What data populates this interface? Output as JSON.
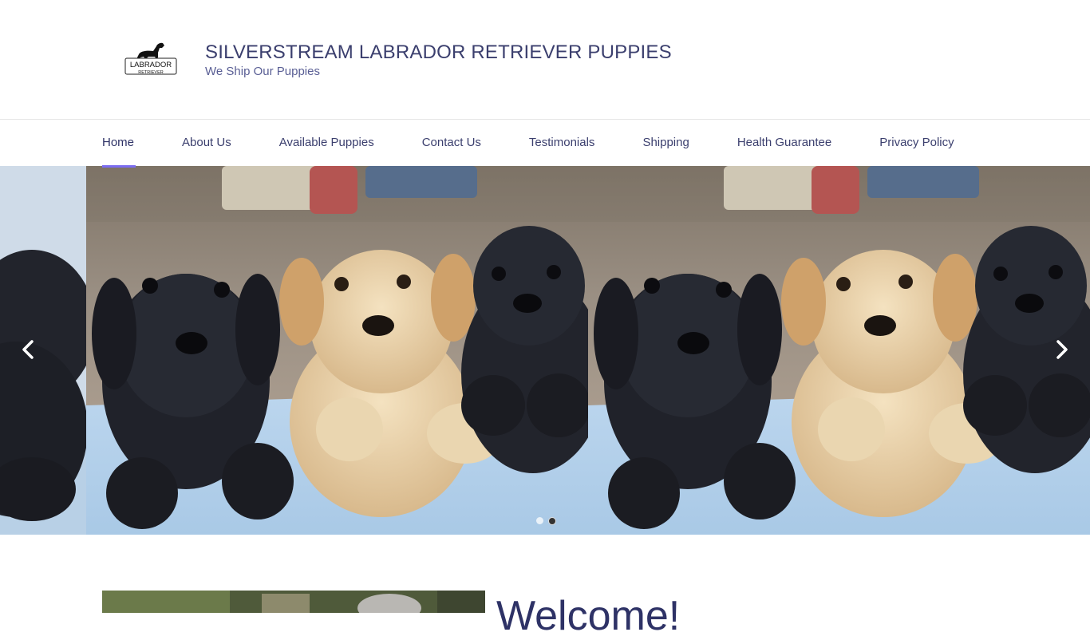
{
  "header": {
    "logo_text_top": "LABRADOR",
    "logo_text_bottom": "RETRIEVER",
    "site_title": "SILVERSTREAM LABRADOR RETRIEVER PUPPIES",
    "tagline": "We Ship Our Puppies"
  },
  "nav": {
    "items": [
      {
        "label": "Home"
      },
      {
        "label": "About Us"
      },
      {
        "label": "Available Puppies"
      },
      {
        "label": "Contact Us"
      },
      {
        "label": "Testimonials"
      },
      {
        "label": "Shipping"
      },
      {
        "label": "Health Guarantee"
      },
      {
        "label": "Privacy Policy"
      }
    ],
    "active": "Home"
  },
  "slider": {
    "icons": {
      "prev": "chevron-left-icon",
      "next": "chevron-right-icon"
    },
    "slides": [
      {
        "name": "three-labrador-puppies-photo"
      },
      {
        "name": "three-labrador-puppies-photo"
      }
    ],
    "dots_count": 2,
    "active_dot": 2
  },
  "welcome": {
    "heading": "Welcome!"
  },
  "colors": {
    "title": "#3b3f6e",
    "tagline": "#5a5f95",
    "nav_text": "#3b3f6e",
    "accent": "#7b6cf0"
  }
}
